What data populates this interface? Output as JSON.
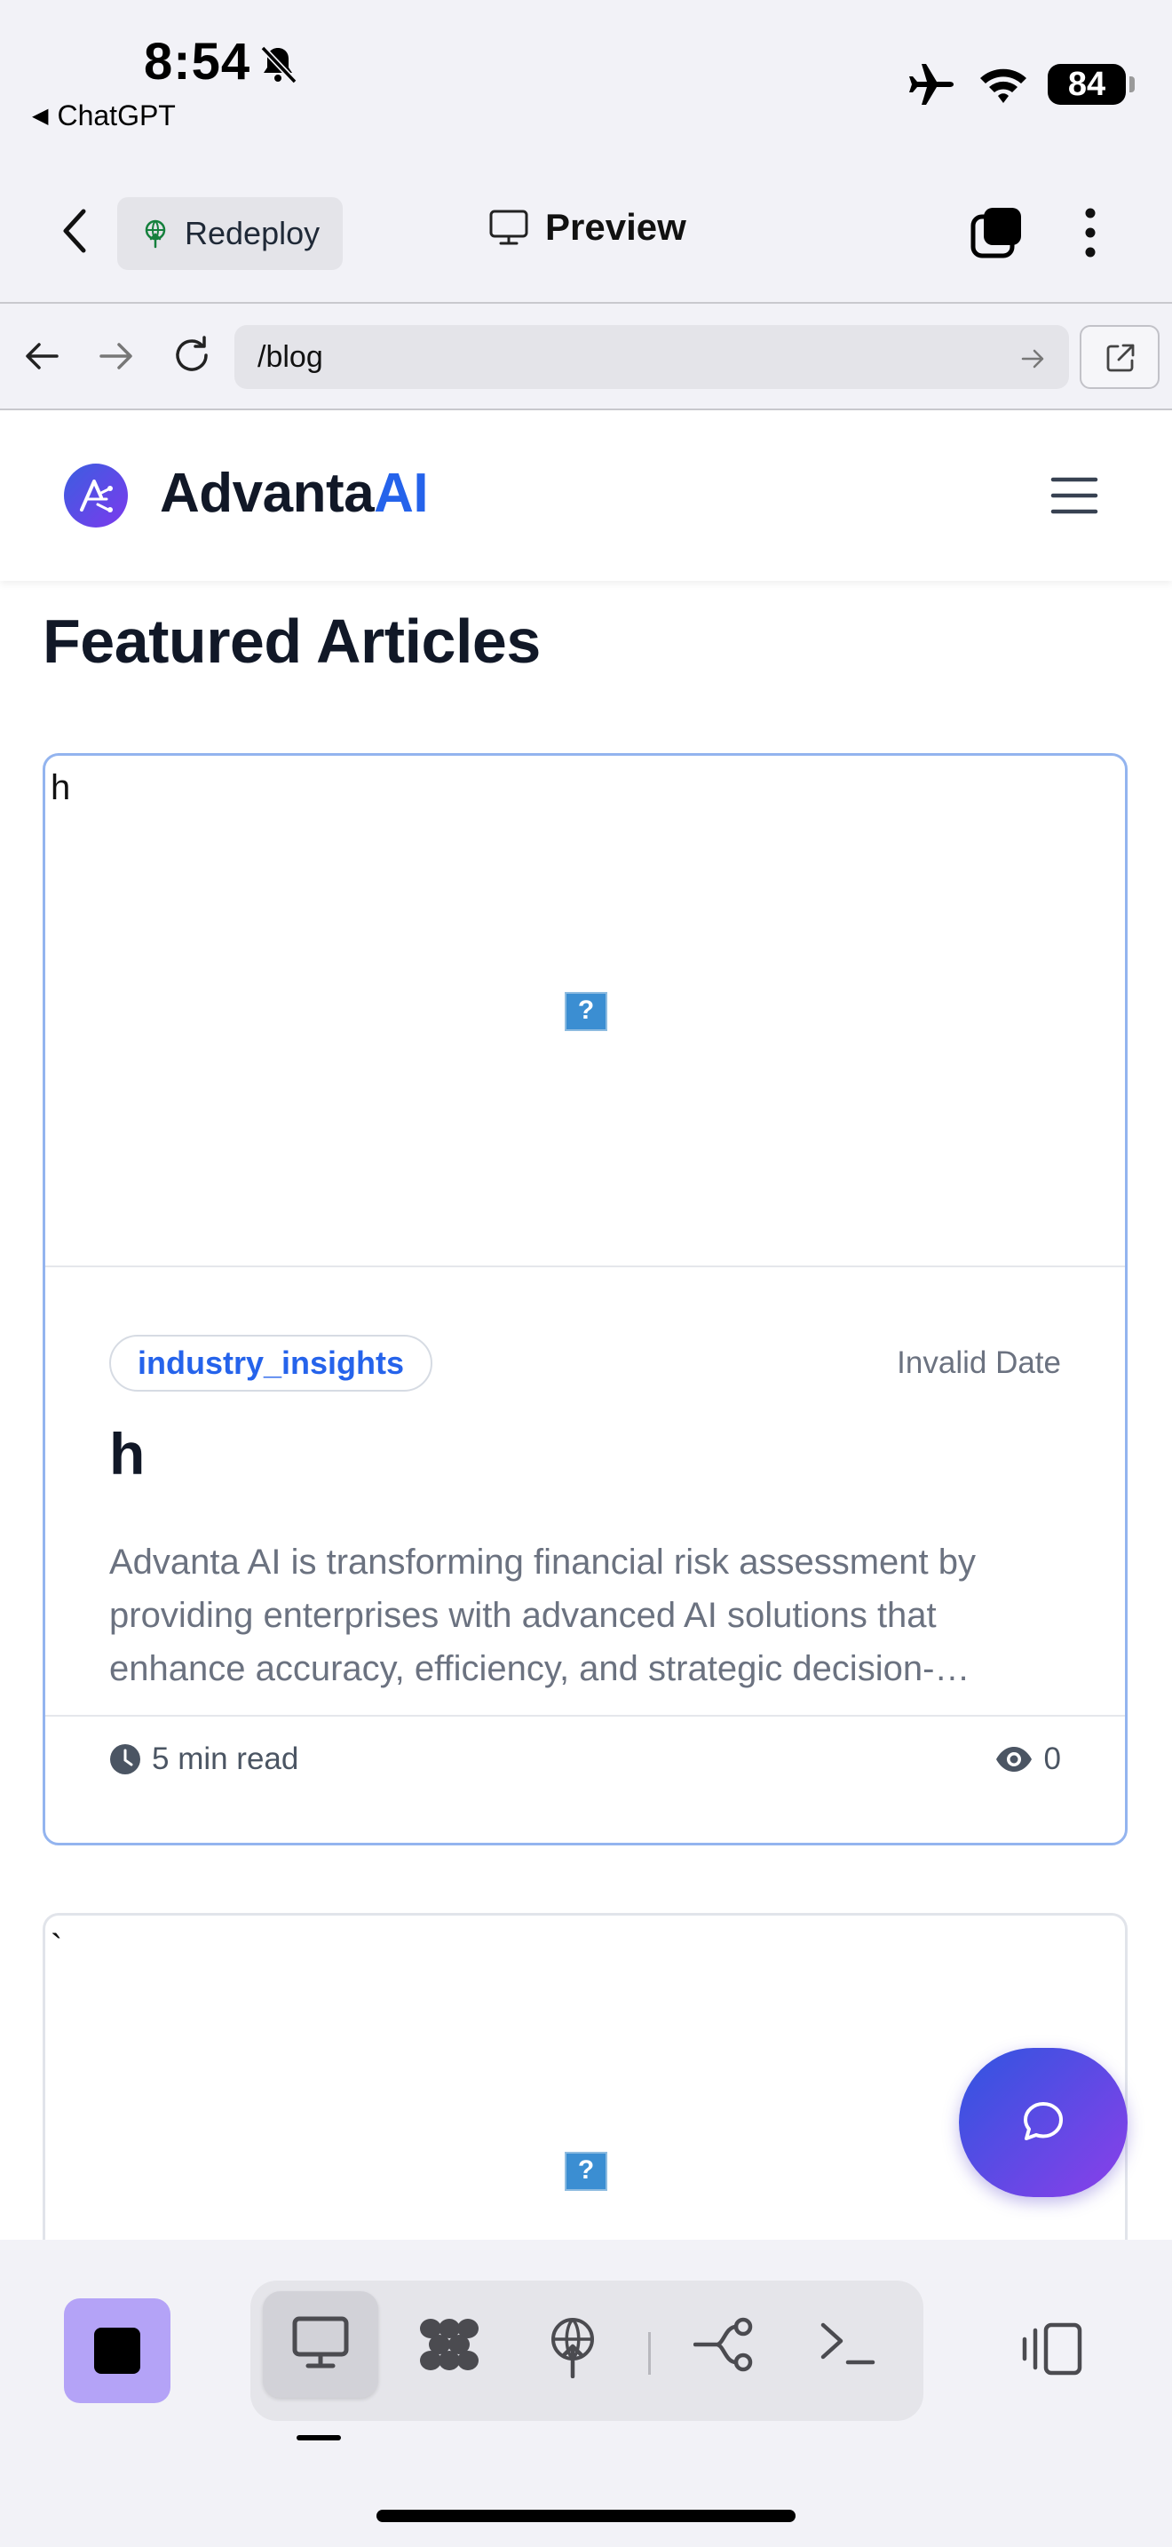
{
  "status_bar": {
    "time": "8:54",
    "back_app": "ChatGPT",
    "battery": "84"
  },
  "app_bar": {
    "redeploy_label": "Redeploy",
    "preview_label": "Preview"
  },
  "browser": {
    "url": "/blog"
  },
  "site_header": {
    "brand_main": "Advanta",
    "brand_accent": "AI"
  },
  "content": {
    "section_title": "Featured Articles",
    "articles": [
      {
        "image_alt": "h",
        "broken_image_glyph": "?",
        "category": "industry_insights",
        "date": "Invalid Date",
        "title": "h",
        "excerpt": "Advanta AI is transforming financial risk assessment by providing enterprises with advanced AI solutions that enhance accuracy, efficiency, and strategic decision-…",
        "read_time": "5 min read",
        "views": "0"
      },
      {
        "image_alt": "`",
        "broken_image_glyph": "?"
      }
    ]
  },
  "colors": {
    "brand_accent": "#2563eb",
    "fab_gradient_start": "#2f55e0",
    "fab_gradient_end": "#8b3fe9",
    "stop_button": "#b4a3f7"
  },
  "icons": {
    "toolbar": [
      "stop-icon",
      "desktop-preview-icon",
      "components-icon",
      "deploy-icon",
      "branch-icon",
      "terminal-icon",
      "panel-toggle-icon"
    ]
  }
}
